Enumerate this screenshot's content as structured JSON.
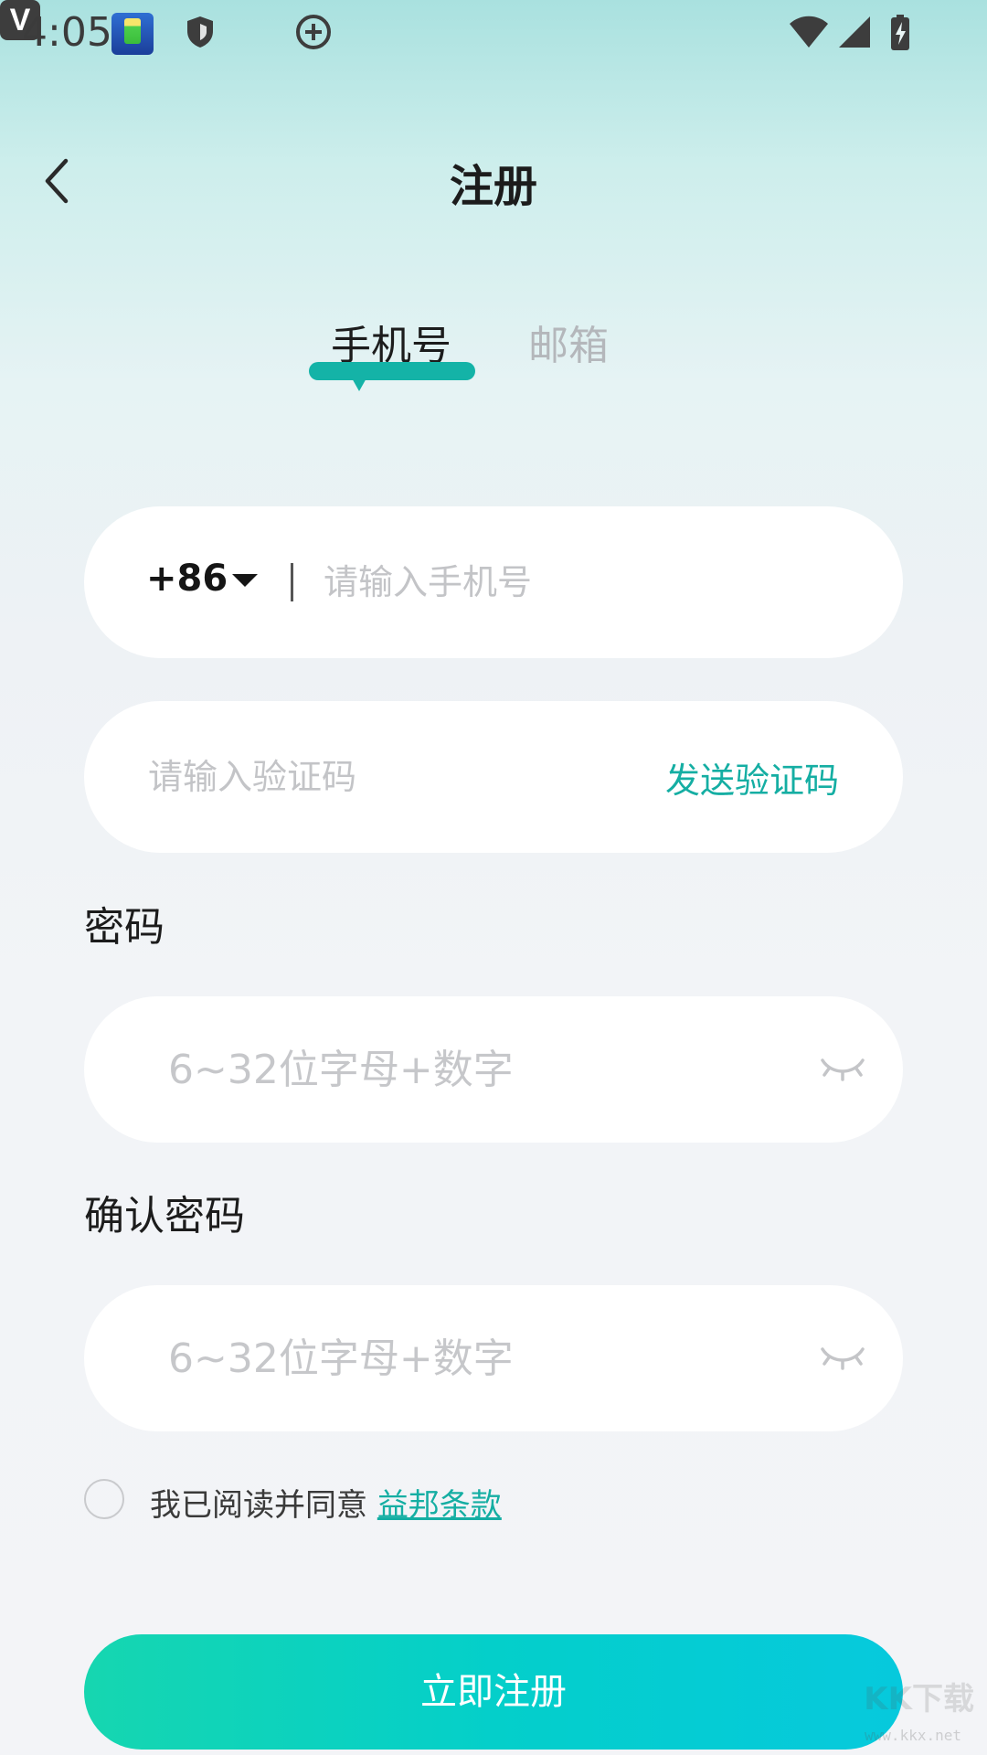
{
  "status_bar": {
    "time": "4:05",
    "v_label": "V"
  },
  "header": {
    "title": "注册"
  },
  "tabs": [
    {
      "label": "手机号",
      "active": true
    },
    {
      "label": "邮箱",
      "active": false
    }
  ],
  "phone_field": {
    "country_code": "+86",
    "placeholder": "请输入手机号"
  },
  "code_field": {
    "placeholder": "请输入验证码",
    "send_label": "发送验证码"
  },
  "password": {
    "label": "密码",
    "placeholder": "6~32位字母+数字"
  },
  "confirm_password": {
    "label": "确认密码",
    "placeholder": "6~32位字母+数字"
  },
  "agreement": {
    "text": "我已阅读并同意 ",
    "link": "益邦条款",
    "checked": false
  },
  "register_button": {
    "label": "立即注册"
  },
  "watermark": {
    "text": "KK下载",
    "url": "www.kkx.net"
  },
  "colors": {
    "accent": "#15aea3",
    "button_gradient_start": "#16d6b0",
    "button_gradient_end": "#06c9dd"
  }
}
